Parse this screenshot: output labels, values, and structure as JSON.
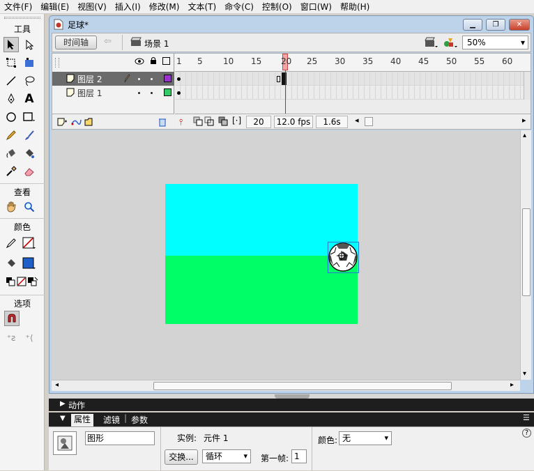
{
  "menu": [
    "文件(F)",
    "编辑(E)",
    "视图(V)",
    "插入(I)",
    "修改(M)",
    "文本(T)",
    "命令(C)",
    "控制(O)",
    "窗口(W)",
    "帮助(H)"
  ],
  "tools": {
    "title": "工具",
    "view_section": "查看",
    "color_section": "颜色",
    "options_section": "选项",
    "stroke_color": "#cc0000",
    "fill_color": "#1e5fc8"
  },
  "document": {
    "title": "足球*",
    "timeline_button": "时间轴",
    "scene": "场景 1",
    "zoom": "50%"
  },
  "timeline": {
    "ruler_ticks": [
      "1",
      "5",
      "10",
      "15",
      "20",
      "25",
      "30",
      "35",
      "40",
      "45",
      "50",
      "55",
      "60"
    ],
    "layers": [
      {
        "name": "图层 2",
        "color": "#9933cc",
        "selected": true
      },
      {
        "name": "图层 1",
        "color": "#33cc66",
        "selected": false
      }
    ],
    "current_frame": "20",
    "fps": "12.0 fps",
    "elapsed": "1.6s"
  },
  "stage": {
    "sky_color": "#00ffff",
    "grass_color": "#00ff66",
    "background": "#d3d3d3"
  },
  "panels": {
    "actions": "动作",
    "tabs": [
      "属性",
      "滤镜",
      "参数"
    ],
    "props": {
      "type_label": "图形",
      "instance_label": "实例:",
      "instance_value": "元件 1",
      "swap_button": "交换...",
      "loop_option": "循环",
      "first_frame_label": "第一帧:",
      "first_frame_value": "1",
      "color_label": "颜色:",
      "color_value": "无",
      "help": "?"
    }
  }
}
